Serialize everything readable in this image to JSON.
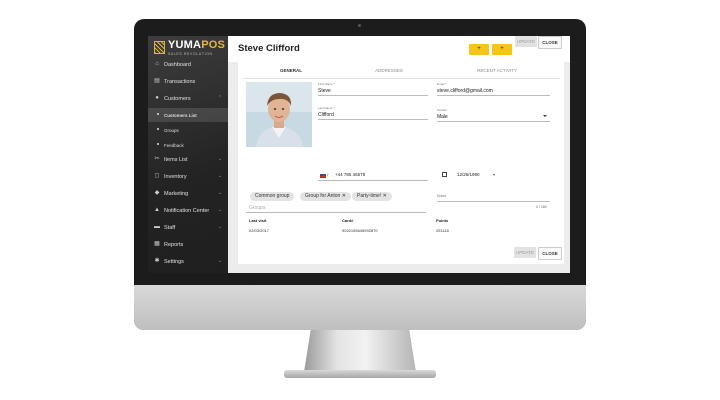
{
  "app": {
    "logo_main": "YUMA",
    "logo_accent": "POS",
    "logo_tagline": "SALES REVOLUTION"
  },
  "sidebar": {
    "items": [
      {
        "label": "Dashboard",
        "icon": "home-icon"
      },
      {
        "label": "Transactions",
        "icon": "receipt-icon"
      },
      {
        "label": "Customers",
        "icon": "people-icon",
        "expanded": true
      },
      {
        "label": "Items List",
        "icon": "scissors-icon"
      },
      {
        "label": "Inventory",
        "icon": "box-icon"
      },
      {
        "label": "Marketing",
        "icon": "megaphone-icon"
      },
      {
        "label": "Notification Center",
        "icon": "bell-icon"
      },
      {
        "label": "Staff",
        "icon": "id-card-icon"
      },
      {
        "label": "Reports",
        "icon": "chart-icon"
      },
      {
        "label": "Settings",
        "icon": "gear-icon"
      }
    ],
    "sub_items": [
      {
        "label": "Customers List",
        "active": true
      },
      {
        "label": "Groups",
        "active": false
      },
      {
        "label": "Feedback",
        "active": false
      }
    ]
  },
  "header": {
    "title": "Steve Clifford",
    "add_button_1": "+",
    "add_button_2": "+",
    "update_label": "UPDATE",
    "close_label": "CLOSE"
  },
  "tabs": [
    "GENERAL",
    "ADDRESSES",
    "RECENT ACTIVITY"
  ],
  "form": {
    "first_name_label": "First Name *",
    "first_name": "Steve",
    "last_name_label": "Last Name *",
    "last_name": "Clifford",
    "email_label": "Email *",
    "email": "steve.clifford@gmail.com",
    "gender_label": "Gender",
    "gender": "Male",
    "phone": "+44 785 45578",
    "birthday": "12/26/1990",
    "groups": [
      "Common group",
      "Group for Anton",
      "Party-time!"
    ],
    "groups_placeholder": "Groups",
    "notes_label": "Notes",
    "notes_counter": "0 / 180",
    "last_visit_label": "Last visit",
    "last_visit": "02/03/2017",
    "card_label": "Card#",
    "card": "9022155645992870",
    "points_label": "Points",
    "points": "251118"
  },
  "footer": {
    "update_label": "UPDATE",
    "close_label": "CLOSE"
  },
  "colors": {
    "accent": "#f5c518",
    "sidebar_bg": "#2a2a2a"
  }
}
